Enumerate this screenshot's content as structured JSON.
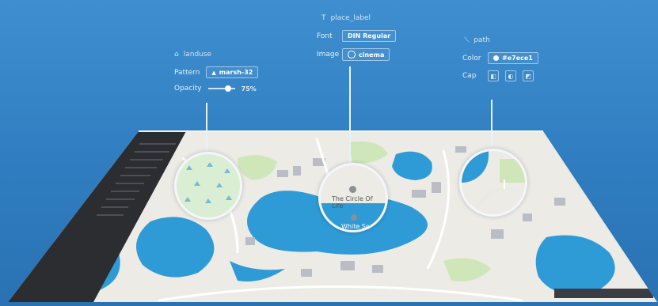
{
  "colors": {
    "background": "#3283c6",
    "water": "#2c9ad6",
    "land": "#eceae4",
    "sidebar": "#2b2d31",
    "park": "#cfe7b8",
    "path": "#e7ece1"
  },
  "landuse": {
    "title": "landuse",
    "icon": "landuse-icon",
    "pattern_label": "Pattern",
    "pattern_value": "marsh-32",
    "opacity_label": "Opacity",
    "opacity_value": "75%",
    "opacity_level": 0.75
  },
  "place_label": {
    "title": "place_label",
    "icon": "text-icon",
    "font_label": "Font",
    "font_value": "DIN Regular",
    "image_label": "Image",
    "image_value": "cinema"
  },
  "path": {
    "title": "path",
    "icon": "path-icon",
    "color_label": "Color",
    "color_value": "#e7ece1",
    "cap_label": "Cap"
  },
  "map": {
    "label_center": "The Circle Of Life",
    "label_lower": "White Sea"
  }
}
